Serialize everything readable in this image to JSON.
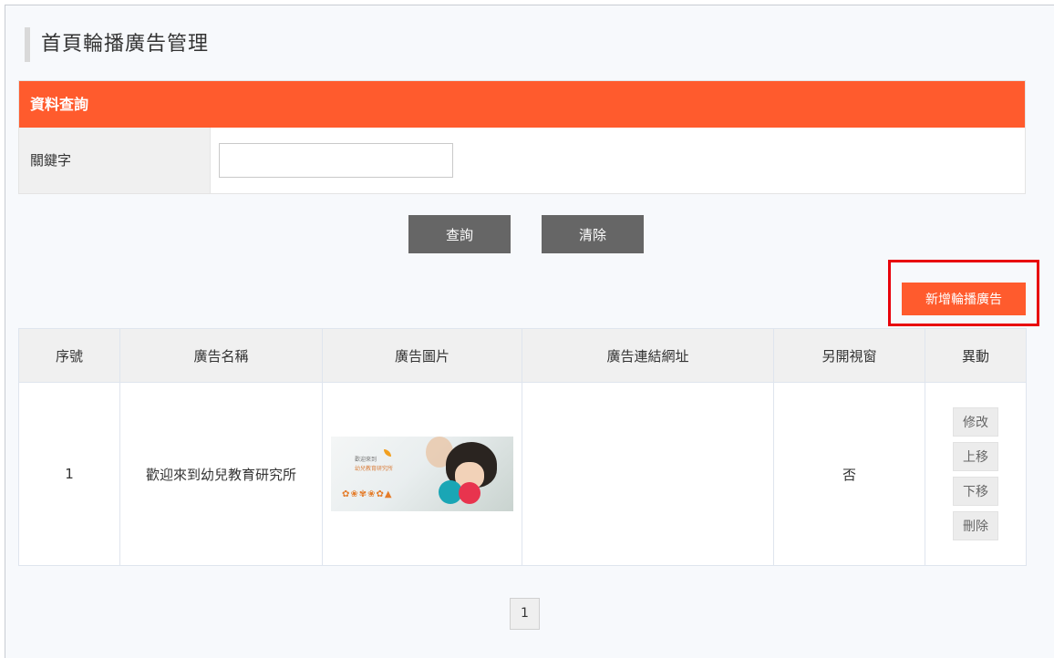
{
  "page": {
    "title": "首頁輪播廣告管理"
  },
  "query": {
    "header": "資料查詢",
    "keyword_label": "關鍵字",
    "keyword_value": "",
    "search_button": "查詢",
    "clear_button": "清除"
  },
  "add_button": "新增輪播廣告",
  "table": {
    "columns": [
      "序號",
      "廣告名稱",
      "廣告圖片",
      "廣告連結網址",
      "另開視窗",
      "異動"
    ],
    "rows": [
      {
        "index": "1",
        "name": "歡迎來到幼兒教育研究所",
        "image_text1": "歡迎來到",
        "image_text2": "幼兒教育研究所",
        "url": "",
        "new_window": "否",
        "actions": [
          "修改",
          "上移",
          "下移",
          "刪除"
        ]
      }
    ]
  },
  "pagination": {
    "current": "1"
  },
  "colors": {
    "accent": "#ff5b2d",
    "highlight": "#e8000b",
    "dark_button": "#666666"
  }
}
